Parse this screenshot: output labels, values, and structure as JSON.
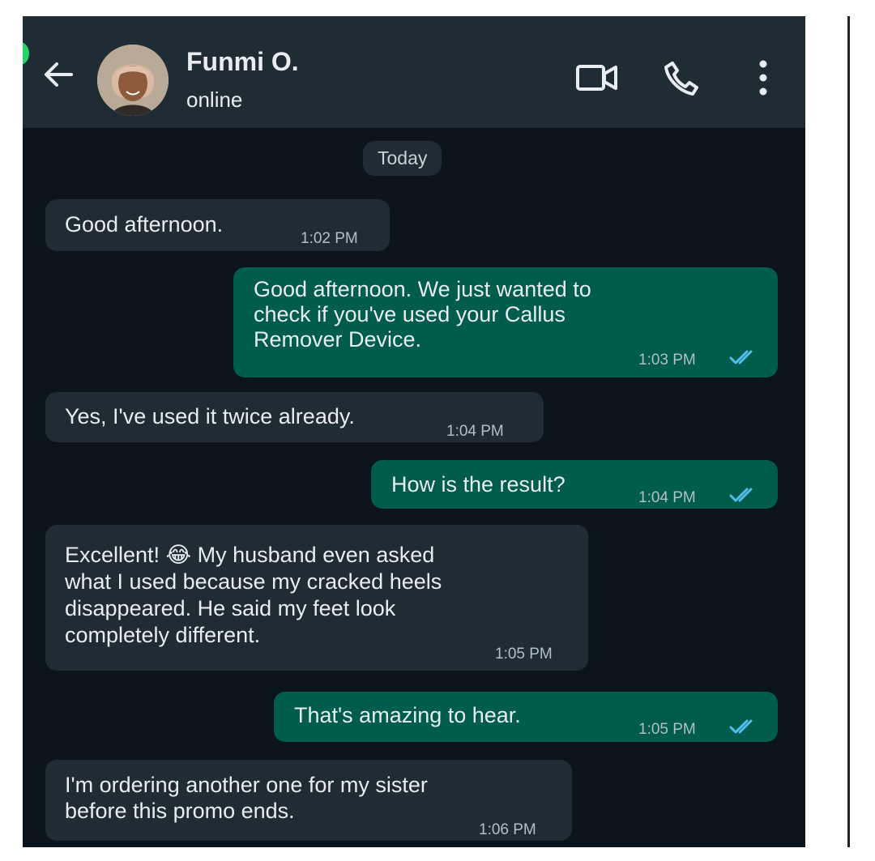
{
  "header": {
    "contact_name": "Funmi O.",
    "status": "online",
    "icons": [
      "back-arrow-icon",
      "avatar",
      "video-call-icon",
      "voice-call-icon",
      "more-options-icon"
    ]
  },
  "chat": {
    "date_label": "Today",
    "messages": [
      {
        "direction": "incoming",
        "lines": [
          "Good afternoon."
        ],
        "time": "1:02 PM"
      },
      {
        "direction": "outgoing",
        "lines": [
          "Good afternoon. We just wanted to",
          "check if you've used your Callus",
          "Remover Device."
        ],
        "time": "1:03 PM",
        "status": "read"
      },
      {
        "direction": "incoming",
        "lines": [
          "Yes, I've used it twice already."
        ],
        "time": "1:04 PM"
      },
      {
        "direction": "outgoing",
        "lines": [
          "How is the result?"
        ],
        "time": "1:04 PM",
        "status": "read"
      },
      {
        "direction": "incoming",
        "lines": [
          "Excellent! 😂 My husband even asked",
          "what I used because my cracked heels",
          "disappeared. He said my feet look",
          "completely different."
        ],
        "time": "1:05 PM"
      },
      {
        "direction": "outgoing",
        "lines": [
          "That's amazing to hear."
        ],
        "time": "1:05 PM",
        "status": "read"
      },
      {
        "direction": "incoming",
        "lines": [
          "I'm ordering another one for my sister",
          "before this promo ends."
        ],
        "time": "1:06 PM"
      }
    ]
  },
  "colors": {
    "background": "#0b141a",
    "header": "#1f2c34",
    "incoming_bubble": "#1f2c34",
    "outgoing_bubble": "#005c4b",
    "read_ticks": "#53bdeb"
  }
}
